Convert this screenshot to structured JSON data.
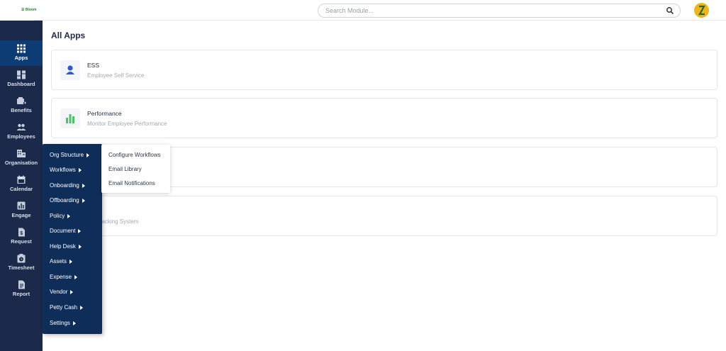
{
  "header": {
    "logo_text": "☰ Bloom",
    "search_placeholder": "Search Module..."
  },
  "sidebar": {
    "items": [
      {
        "label": "Apps",
        "icon": "apps-grid-icon",
        "active": true
      },
      {
        "label": "Dashboard",
        "icon": "dashboard-icon"
      },
      {
        "label": "Benefits",
        "icon": "benefits-icon"
      },
      {
        "label": "Employees",
        "icon": "employees-icon"
      },
      {
        "label": "Organisation",
        "icon": "organisation-icon"
      },
      {
        "label": "Calendar",
        "icon": "calendar-icon"
      },
      {
        "label": "Engage",
        "icon": "engage-chart-icon"
      },
      {
        "label": "Request",
        "icon": "request-icon"
      },
      {
        "label": "Timesheet",
        "icon": "timesheet-icon"
      },
      {
        "label": "Report",
        "icon": "report-icon"
      }
    ]
  },
  "main": {
    "title": "All Apps",
    "cards": [
      {
        "title": "ESS",
        "subtitle": "Employee Self Service",
        "icon": "person-icon",
        "icon_color": "#2b59d6"
      },
      {
        "title": "Performance",
        "subtitle": "Monitor Employee Performance",
        "icon": "bar-chart-icon",
        "icon_color": "#4cc36b"
      },
      {
        "title": "",
        "subtitle": ""
      },
      {
        "title": "",
        "subtitle": "ant Tracking System"
      }
    ]
  },
  "flyout": {
    "items": [
      {
        "label": "Org Structure"
      },
      {
        "label": "Workflows"
      },
      {
        "label": "Onboarding"
      },
      {
        "label": "Offboarding"
      },
      {
        "label": "Policy"
      },
      {
        "label": "Document"
      },
      {
        "label": "Help Desk"
      },
      {
        "label": "Assets"
      },
      {
        "label": "Expense"
      },
      {
        "label": "Vendor"
      },
      {
        "label": "Petty Cash"
      },
      {
        "label": "Settings"
      }
    ]
  },
  "submenu": {
    "items": [
      {
        "label": "Configure Workflows"
      },
      {
        "label": "Email Library"
      },
      {
        "label": "Email Notifications"
      }
    ]
  },
  "colors": {
    "sidebar_bg": "#1b2a4a",
    "sidebar_active": "#0d3b73",
    "flyout_bg": "#0f2d59",
    "avatar": "#f2b418"
  }
}
